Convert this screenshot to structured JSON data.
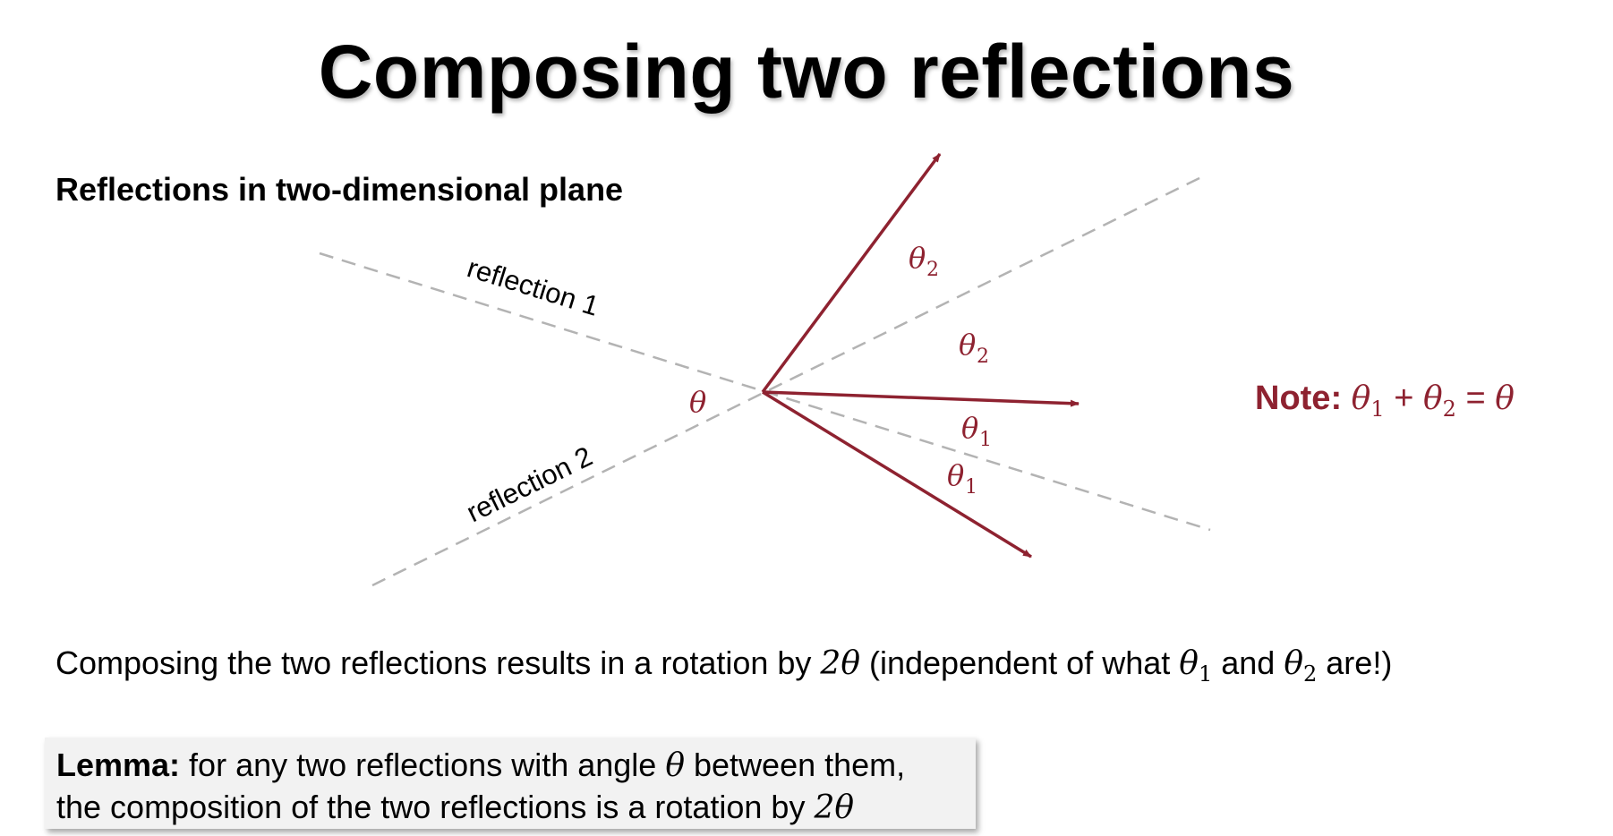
{
  "title": "Composing two reflections",
  "subtitle": "Reflections in two-dimensional plane",
  "diagram": {
    "line_labels": [
      "reflection 1",
      "reflection 2"
    ],
    "center_angle": "θ",
    "angle_labels": [
      {
        "symbol": "θ",
        "sub": "2"
      },
      {
        "symbol": "θ",
        "sub": "2"
      },
      {
        "symbol": "θ",
        "sub": "1"
      },
      {
        "symbol": "θ",
        "sub": "1"
      }
    ],
    "colors": {
      "arrow": "#8e2230",
      "dashed_line": "#b3b3b3"
    }
  },
  "note": {
    "label": "Note:",
    "theta": "θ",
    "sub1": "1",
    "plus": " + ",
    "sub2": "2",
    "equals": " = ",
    "result": "θ"
  },
  "statement": {
    "part1": "Composing the two reflections results in a rotation by ",
    "two_theta": "2θ",
    "part2": " (independent of what ",
    "theta": "θ",
    "sub1": "1",
    "part3": " and ",
    "sub2": "2",
    "part4": " are!)"
  },
  "lemma": {
    "label": "Lemma:",
    "text1": " for any two reflections with angle ",
    "theta": "θ",
    "text2": " between them,",
    "text3": "the composition of the two reflections is a rotation by ",
    "two_theta": "2θ"
  }
}
